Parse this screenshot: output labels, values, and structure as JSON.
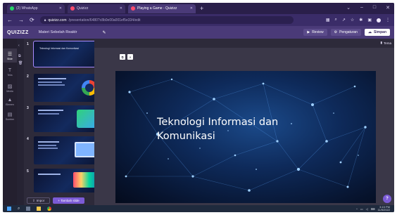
{
  "browser": {
    "tabs": [
      {
        "label": "(2) WhatsApp",
        "icon": "whatsapp-icon",
        "color": "#25d366"
      },
      {
        "label": "Quizizz",
        "icon": "quizizz-icon",
        "color": "#ff4d6d"
      },
      {
        "label": "Playing a Game - Quizizz",
        "icon": "quizizz-icon",
        "color": "#ff4d6d"
      }
    ],
    "new_tab": "+",
    "url_host": "quizizz.com",
    "url_path": "/presentation/6480?c8b0e00a001ef5e334/edit"
  },
  "app": {
    "logo": "QUIZIZZ",
    "doc_title": "Materi Sebelah Reaktr",
    "actions": {
      "review": "Review",
      "settings": "Pengaturan",
      "save": "Simpan"
    }
  },
  "left_tools": [
    {
      "label": "Slide",
      "icon": "slide-icon"
    },
    {
      "label": "Teks",
      "icon": "text-icon"
    },
    {
      "label": "Media",
      "icon": "media-icon"
    },
    {
      "label": "Elemen",
      "icon": "elements-icon"
    },
    {
      "label": "Sumber",
      "icon": "source-icon"
    }
  ],
  "thumbnails": [
    {
      "num": "1",
      "title": "Teknologi Informasi dan Komunikasi"
    },
    {
      "num": "2",
      "title": ""
    },
    {
      "num": "3",
      "title": ""
    },
    {
      "num": "4",
      "title": ""
    },
    {
      "num": "5",
      "title": ""
    }
  ],
  "thumb_footer": {
    "import": "Impor",
    "add": "+ Tambah slide"
  },
  "canvas": {
    "theme": "Tema",
    "slide_title": "Teknologi Informasi dan Komunikasi"
  },
  "help": "?",
  "taskbar": {
    "time": "3:15 PM",
    "date": "11/5/2022"
  }
}
